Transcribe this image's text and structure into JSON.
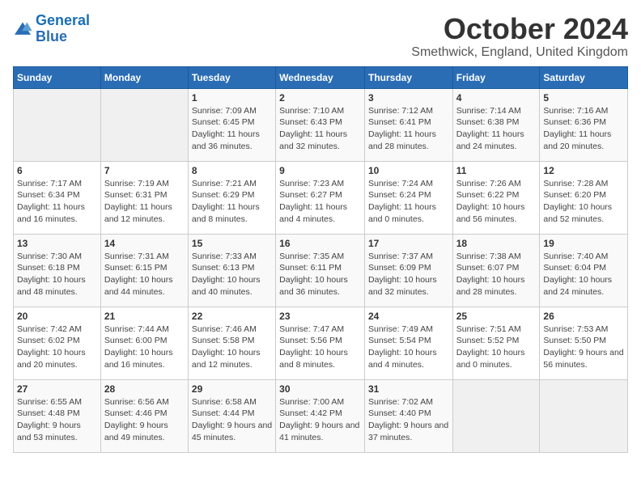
{
  "header": {
    "logo_line1": "General",
    "logo_line2": "Blue",
    "month": "October 2024",
    "location": "Smethwick, England, United Kingdom"
  },
  "days_of_week": [
    "Sunday",
    "Monday",
    "Tuesday",
    "Wednesday",
    "Thursday",
    "Friday",
    "Saturday"
  ],
  "weeks": [
    [
      {
        "day": "",
        "detail": ""
      },
      {
        "day": "",
        "detail": ""
      },
      {
        "day": "1",
        "detail": "Sunrise: 7:09 AM\nSunset: 6:45 PM\nDaylight: 11 hours and 36 minutes."
      },
      {
        "day": "2",
        "detail": "Sunrise: 7:10 AM\nSunset: 6:43 PM\nDaylight: 11 hours and 32 minutes."
      },
      {
        "day": "3",
        "detail": "Sunrise: 7:12 AM\nSunset: 6:41 PM\nDaylight: 11 hours and 28 minutes."
      },
      {
        "day": "4",
        "detail": "Sunrise: 7:14 AM\nSunset: 6:38 PM\nDaylight: 11 hours and 24 minutes."
      },
      {
        "day": "5",
        "detail": "Sunrise: 7:16 AM\nSunset: 6:36 PM\nDaylight: 11 hours and 20 minutes."
      }
    ],
    [
      {
        "day": "6",
        "detail": "Sunrise: 7:17 AM\nSunset: 6:34 PM\nDaylight: 11 hours and 16 minutes."
      },
      {
        "day": "7",
        "detail": "Sunrise: 7:19 AM\nSunset: 6:31 PM\nDaylight: 11 hours and 12 minutes."
      },
      {
        "day": "8",
        "detail": "Sunrise: 7:21 AM\nSunset: 6:29 PM\nDaylight: 11 hours and 8 minutes."
      },
      {
        "day": "9",
        "detail": "Sunrise: 7:23 AM\nSunset: 6:27 PM\nDaylight: 11 hours and 4 minutes."
      },
      {
        "day": "10",
        "detail": "Sunrise: 7:24 AM\nSunset: 6:24 PM\nDaylight: 11 hours and 0 minutes."
      },
      {
        "day": "11",
        "detail": "Sunrise: 7:26 AM\nSunset: 6:22 PM\nDaylight: 10 hours and 56 minutes."
      },
      {
        "day": "12",
        "detail": "Sunrise: 7:28 AM\nSunset: 6:20 PM\nDaylight: 10 hours and 52 minutes."
      }
    ],
    [
      {
        "day": "13",
        "detail": "Sunrise: 7:30 AM\nSunset: 6:18 PM\nDaylight: 10 hours and 48 minutes."
      },
      {
        "day": "14",
        "detail": "Sunrise: 7:31 AM\nSunset: 6:15 PM\nDaylight: 10 hours and 44 minutes."
      },
      {
        "day": "15",
        "detail": "Sunrise: 7:33 AM\nSunset: 6:13 PM\nDaylight: 10 hours and 40 minutes."
      },
      {
        "day": "16",
        "detail": "Sunrise: 7:35 AM\nSunset: 6:11 PM\nDaylight: 10 hours and 36 minutes."
      },
      {
        "day": "17",
        "detail": "Sunrise: 7:37 AM\nSunset: 6:09 PM\nDaylight: 10 hours and 32 minutes."
      },
      {
        "day": "18",
        "detail": "Sunrise: 7:38 AM\nSunset: 6:07 PM\nDaylight: 10 hours and 28 minutes."
      },
      {
        "day": "19",
        "detail": "Sunrise: 7:40 AM\nSunset: 6:04 PM\nDaylight: 10 hours and 24 minutes."
      }
    ],
    [
      {
        "day": "20",
        "detail": "Sunrise: 7:42 AM\nSunset: 6:02 PM\nDaylight: 10 hours and 20 minutes."
      },
      {
        "day": "21",
        "detail": "Sunrise: 7:44 AM\nSunset: 6:00 PM\nDaylight: 10 hours and 16 minutes."
      },
      {
        "day": "22",
        "detail": "Sunrise: 7:46 AM\nSunset: 5:58 PM\nDaylight: 10 hours and 12 minutes."
      },
      {
        "day": "23",
        "detail": "Sunrise: 7:47 AM\nSunset: 5:56 PM\nDaylight: 10 hours and 8 minutes."
      },
      {
        "day": "24",
        "detail": "Sunrise: 7:49 AM\nSunset: 5:54 PM\nDaylight: 10 hours and 4 minutes."
      },
      {
        "day": "25",
        "detail": "Sunrise: 7:51 AM\nSunset: 5:52 PM\nDaylight: 10 hours and 0 minutes."
      },
      {
        "day": "26",
        "detail": "Sunrise: 7:53 AM\nSunset: 5:50 PM\nDaylight: 9 hours and 56 minutes."
      }
    ],
    [
      {
        "day": "27",
        "detail": "Sunrise: 6:55 AM\nSunset: 4:48 PM\nDaylight: 9 hours and 53 minutes."
      },
      {
        "day": "28",
        "detail": "Sunrise: 6:56 AM\nSunset: 4:46 PM\nDaylight: 9 hours and 49 minutes."
      },
      {
        "day": "29",
        "detail": "Sunrise: 6:58 AM\nSunset: 4:44 PM\nDaylight: 9 hours and 45 minutes."
      },
      {
        "day": "30",
        "detail": "Sunrise: 7:00 AM\nSunset: 4:42 PM\nDaylight: 9 hours and 41 minutes."
      },
      {
        "day": "31",
        "detail": "Sunrise: 7:02 AM\nSunset: 4:40 PM\nDaylight: 9 hours and 37 minutes."
      },
      {
        "day": "",
        "detail": ""
      },
      {
        "day": "",
        "detail": ""
      }
    ]
  ]
}
